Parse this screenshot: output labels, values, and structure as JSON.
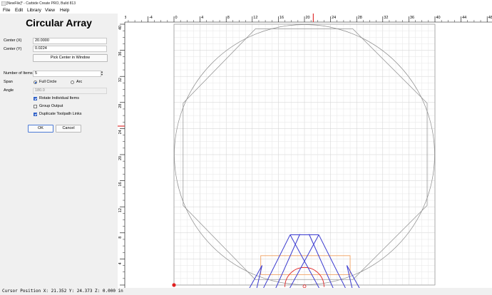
{
  "window": {
    "title": "[NewFile]* - Carbide Create PRO, Build 813"
  },
  "menu": [
    "File",
    "Edit",
    "Library",
    "View",
    "Help"
  ],
  "panel": {
    "title": "Circular Array",
    "center_x_label": "Center (X)",
    "center_x_value": "20.0000",
    "center_y_label": "Center (Y)",
    "center_y_value": "0.0224",
    "pick_center_label": "Pick Center in Window",
    "num_items_label": "Number of Items",
    "num_items_value": "5",
    "span_label": "Span",
    "full_circle_label": "Full Circle",
    "arc_label": "Arc",
    "span_selected": "Full Circle",
    "angle_label": "Angle",
    "angle_value": "180.0",
    "rotate_label": "Rotate Individual Items",
    "rotate_checked": true,
    "group_label": "Group Output",
    "group_checked": false,
    "duplicate_label": "Duplicate Toolpath Links",
    "duplicate_checked": true,
    "ok_label": "OK",
    "cancel_label": "Cancel"
  },
  "ruler": {
    "x_ticks": [
      "-8",
      "-4",
      "0",
      "4",
      "8",
      "12",
      "16",
      "20",
      "24",
      "28",
      "32",
      "36",
      "40",
      "44",
      "48"
    ],
    "y_ticks": [
      "40",
      "36",
      "32",
      "28",
      "24",
      "20",
      "16",
      "12",
      "8",
      "4",
      "0"
    ],
    "cursor_marker_color": "#e03030"
  },
  "drawing": {
    "stock_border_color": "#9a9a9a",
    "outline_color": "#8c8c8c",
    "vector_color": "#3a3ad0",
    "toolpath_color": "#f0a060",
    "arc_color": "#e02020",
    "octagon_pts": [
      [
        12.5,
        39.3
      ],
      [
        27.4,
        39.3
      ],
      [
        38.8,
        27.9
      ],
      [
        38.8,
        12.2
      ],
      [
        27.4,
        0.8
      ],
      [
        12.5,
        0.8
      ],
      [
        1.4,
        12.2
      ],
      [
        1.4,
        27.9
      ]
    ],
    "blue_segments": [
      [
        [
          17.8,
          7.7
        ],
        [
          22.7,
          -1.3
        ]
      ],
      [
        [
          17.8,
          7.7
        ],
        [
          13.3,
          -1.3
        ]
      ],
      [
        [
          19.3,
          7.8
        ],
        [
          15.5,
          -0.7
        ]
      ],
      [
        [
          20.7,
          7.8
        ],
        [
          24.5,
          -0.7
        ]
      ],
      [
        [
          22.2,
          7.7
        ],
        [
          26.7,
          -1.3
        ]
      ],
      [
        [
          22.2,
          7.7
        ],
        [
          17.3,
          -1.3
        ]
      ],
      [
        [
          17.8,
          7.7
        ],
        [
          22.2,
          7.7
        ]
      ],
      [
        [
          13.5,
          3.0
        ],
        [
          11.5,
          -0.6
        ]
      ],
      [
        [
          26.5,
          3.0
        ],
        [
          28.5,
          -0.6
        ]
      ],
      [
        [
          13.5,
          3.0
        ],
        [
          12.5,
          -1.3
        ]
      ],
      [
        [
          26.5,
          3.0
        ],
        [
          27.5,
          -1.3
        ]
      ]
    ],
    "orange_rect": {
      "x0": 13.3,
      "x1": 27.0,
      "y0": 1.6,
      "y1": 4.5
    }
  },
  "status": {
    "text": "Cursor Position X: 21.352 Y: 24.373 Z: 0.000 in"
  }
}
